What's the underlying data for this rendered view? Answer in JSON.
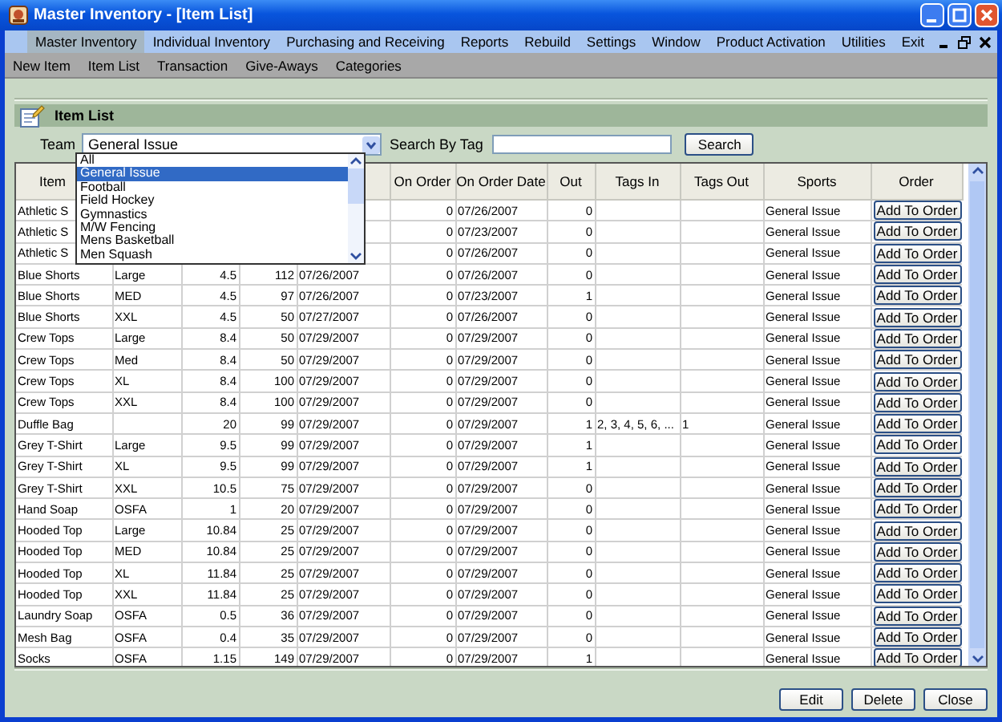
{
  "window": {
    "title": "Master Inventory - [Item List]"
  },
  "menu": [
    {
      "label": "Master Inventory",
      "selected": true
    },
    {
      "label": "Individual Inventory",
      "selected": false
    },
    {
      "label": "Purchasing and Receiving",
      "selected": false
    },
    {
      "label": "Reports",
      "selected": false
    },
    {
      "label": "Rebuild",
      "selected": false
    },
    {
      "label": "Settings",
      "selected": false
    },
    {
      "label": "Window",
      "selected": false
    },
    {
      "label": "Product Activation",
      "selected": false
    },
    {
      "label": "Utilities",
      "selected": false
    },
    {
      "label": "Exit",
      "selected": false
    }
  ],
  "submenu": [
    "New Item",
    "Item List",
    "Transaction",
    "Give-Aways",
    "Categories"
  ],
  "panel": {
    "title": "Item List"
  },
  "filters": {
    "team_label": "Team",
    "team_value": "General Issue",
    "tag_label": "Search By Tag",
    "search_button": "Search"
  },
  "team_dropdown": [
    {
      "label": "All",
      "selected": false
    },
    {
      "label": "General Issue",
      "selected": true
    },
    {
      "label": "Football",
      "selected": false
    },
    {
      "label": "Field Hockey",
      "selected": false
    },
    {
      "label": "Gymnastics",
      "selected": false
    },
    {
      "label": "M/W Fencing",
      "selected": false
    },
    {
      "label": "Mens Basketball",
      "selected": false
    },
    {
      "label": "Men Squash",
      "selected": false
    }
  ],
  "table": {
    "columns": [
      "Item",
      null,
      null,
      null,
      null,
      "On Order",
      "On Order Date",
      "Out",
      "Tags In",
      "Tags Out",
      "Sports",
      "Order"
    ],
    "rows": [
      {
        "cells": [
          "Athletic S",
          null,
          null,
          null,
          null,
          "0",
          "07/26/2007",
          "0",
          null,
          null,
          "General Issue"
        ],
        "button": "Add To Order"
      },
      {
        "cells": [
          "Athletic S",
          null,
          null,
          null,
          null,
          "0",
          "07/23/2007",
          "0",
          null,
          null,
          "General Issue"
        ],
        "button": "Add To Order"
      },
      {
        "cells": [
          "Athletic S",
          null,
          null,
          null,
          null,
          "0",
          "07/26/2007",
          "0",
          null,
          null,
          "General Issue"
        ],
        "button": "Add To Order"
      },
      {
        "cells": [
          "Blue Shorts",
          "Large",
          "4.5",
          "112",
          "07/26/2007",
          "0",
          "07/26/2007",
          "0",
          null,
          null,
          "General Issue"
        ],
        "button": "Add To Order"
      },
      {
        "cells": [
          "Blue Shorts",
          "MED",
          "4.5",
          "97",
          "07/26/2007",
          "0",
          "07/23/2007",
          "1",
          null,
          null,
          "General Issue"
        ],
        "button": "Add To Order"
      },
      {
        "cells": [
          "Blue Shorts",
          "XXL",
          "4.5",
          "50",
          "07/27/2007",
          "0",
          "07/26/2007",
          "0",
          null,
          null,
          "General Issue"
        ],
        "button": "Add To Order"
      },
      {
        "cells": [
          "Crew Tops",
          "Large",
          "8.4",
          "50",
          "07/29/2007",
          "0",
          "07/29/2007",
          "0",
          null,
          null,
          "General Issue"
        ],
        "button": "Add To Order"
      },
      {
        "cells": [
          "Crew Tops",
          "Med",
          "8.4",
          "50",
          "07/29/2007",
          "0",
          "07/29/2007",
          "0",
          null,
          null,
          "General Issue"
        ],
        "button": "Add To Order"
      },
      {
        "cells": [
          "Crew Tops",
          "XL",
          "8.4",
          "100",
          "07/29/2007",
          "0",
          "07/29/2007",
          "0",
          null,
          null,
          "General Issue"
        ],
        "button": "Add To Order"
      },
      {
        "cells": [
          "Crew Tops",
          "XXL",
          "8.4",
          "100",
          "07/29/2007",
          "0",
          "07/29/2007",
          "0",
          null,
          null,
          "General Issue"
        ],
        "button": "Add To Order"
      },
      {
        "cells": [
          "Duffle Bag",
          null,
          "20",
          "99",
          "07/29/2007",
          "0",
          "07/29/2007",
          "1",
          "2, 3, 4, 5, 6, ...",
          "1",
          "General Issue"
        ],
        "button": "Add To Order"
      },
      {
        "cells": [
          "Grey T-Shirt",
          "Large",
          "9.5",
          "99",
          "07/29/2007",
          "0",
          "07/29/2007",
          "1",
          null,
          null,
          "General Issue"
        ],
        "button": "Add To Order"
      },
      {
        "cells": [
          "Grey T-Shirt",
          "XL",
          "9.5",
          "99",
          "07/29/2007",
          "0",
          "07/29/2007",
          "1",
          null,
          null,
          "General Issue"
        ],
        "button": "Add To Order"
      },
      {
        "cells": [
          "Grey T-Shirt",
          "XXL",
          "10.5",
          "75",
          "07/29/2007",
          "0",
          "07/29/2007",
          "0",
          null,
          null,
          "General Issue"
        ],
        "button": "Add To Order"
      },
      {
        "cells": [
          "Hand Soap",
          "OSFA",
          "1",
          "20",
          "07/29/2007",
          "0",
          "07/29/2007",
          "0",
          null,
          null,
          "General Issue"
        ],
        "button": "Add To Order"
      },
      {
        "cells": [
          "Hooded Top",
          "Large",
          "10.84",
          "25",
          "07/29/2007",
          "0",
          "07/29/2007",
          "0",
          null,
          null,
          "General Issue"
        ],
        "button": "Add To Order"
      },
      {
        "cells": [
          "Hooded Top",
          "MED",
          "10.84",
          "25",
          "07/29/2007",
          "0",
          "07/29/2007",
          "0",
          null,
          null,
          "General Issue"
        ],
        "button": "Add To Order"
      },
      {
        "cells": [
          "Hooded Top",
          "XL",
          "11.84",
          "25",
          "07/29/2007",
          "0",
          "07/29/2007",
          "0",
          null,
          null,
          "General Issue"
        ],
        "button": "Add To Order"
      },
      {
        "cells": [
          "Hooded Top",
          "XXL",
          "11.84",
          "25",
          "07/29/2007",
          "0",
          "07/29/2007",
          "0",
          null,
          null,
          "General Issue"
        ],
        "button": "Add To Order"
      },
      {
        "cells": [
          "Laundry Soap",
          "OSFA",
          "0.5",
          "36",
          "07/29/2007",
          "0",
          "07/29/2007",
          "0",
          null,
          null,
          "General Issue"
        ],
        "button": "Add To Order"
      },
      {
        "cells": [
          "Mesh Bag",
          "OSFA",
          "0.4",
          "35",
          "07/29/2007",
          "0",
          "07/29/2007",
          "0",
          null,
          null,
          "General Issue"
        ],
        "button": "Add To Order"
      },
      {
        "cells": [
          "Socks",
          "OSFA",
          "1.15",
          "149",
          "07/29/2007",
          "0",
          "07/29/2007",
          "1",
          null,
          null,
          "General Issue"
        ],
        "button": "Add To Order"
      }
    ]
  },
  "buttons": [
    "Edit",
    "Delete",
    "Close"
  ]
}
